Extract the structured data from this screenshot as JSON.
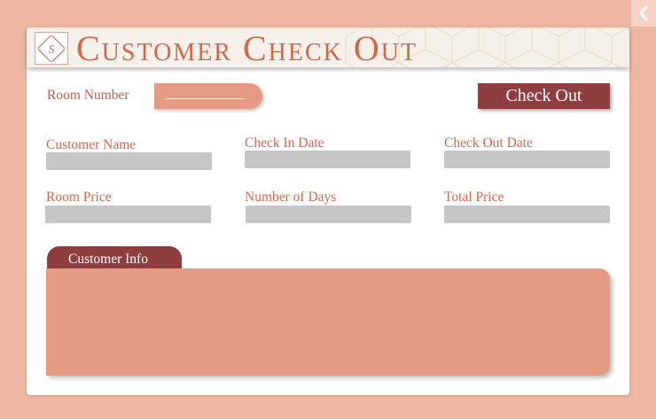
{
  "header": {
    "title": "Customer Check Out",
    "logo_icon": "hotel-monogram-icon",
    "pattern": "hexagon-line-pattern"
  },
  "nav": {
    "back_icon": "chevron-left-icon"
  },
  "room": {
    "label": "Room Number",
    "value": ""
  },
  "actions": {
    "checkout_label": "Check Out"
  },
  "fields": {
    "customer_name": {
      "label": "Customer Name",
      "value": ""
    },
    "check_in_date": {
      "label": "Check In Date",
      "value": ""
    },
    "check_out_date": {
      "label": "Check Out Date",
      "value": ""
    },
    "room_price": {
      "label": "Room Price",
      "value": ""
    },
    "number_of_days": {
      "label": "Number of Days",
      "value": ""
    },
    "total_price": {
      "label": "Total Price",
      "value": ""
    }
  },
  "info": {
    "tab_label": "Customer Info",
    "content": ""
  },
  "colors": {
    "background": "#eeb7a4",
    "accent": "#d2674a",
    "button": "#8e3e3e",
    "pill": "#e59a84",
    "field": "#c6c6c6"
  }
}
